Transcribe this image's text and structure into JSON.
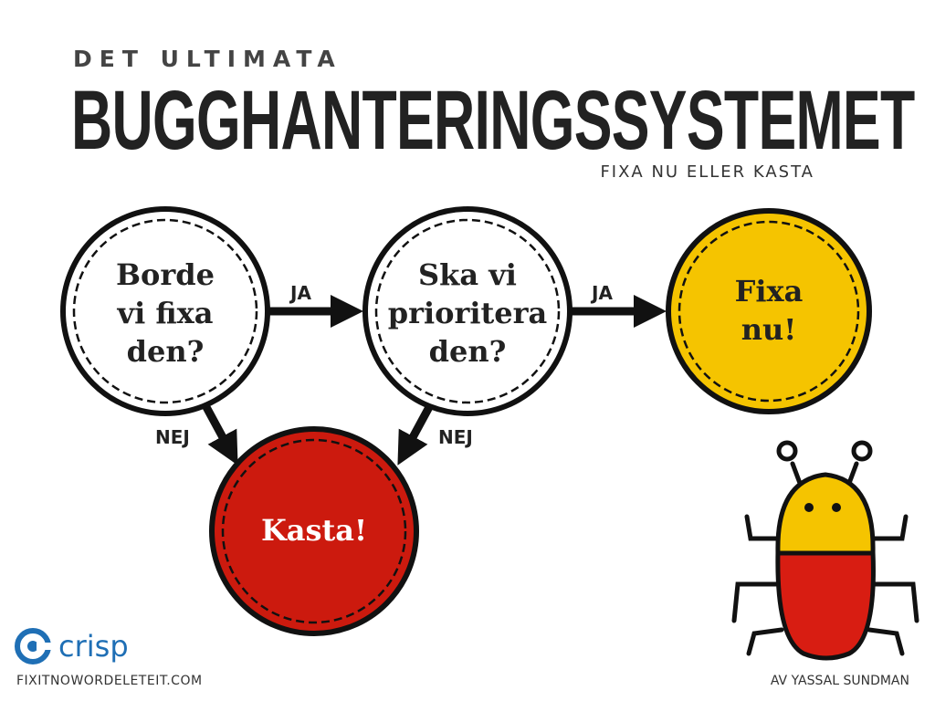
{
  "header": {
    "subtitle": "DET ULTIMATA",
    "title": "BUGGHANTERINGSSYSTEMET",
    "tagline": "FIXA NU ELLER KASTA"
  },
  "nodes": {
    "fix_question": [
      "Borde",
      "vi fixa",
      "den?"
    ],
    "prioritize_question": [
      "Ska vi",
      "prioritera",
      "den?"
    ],
    "fix_now": [
      "Fixa",
      "nu!"
    ],
    "discard": [
      "Kasta!"
    ]
  },
  "edges": {
    "yes_1": "JA",
    "yes_2": "JA",
    "no_1": "NEJ",
    "no_2": "NEJ"
  },
  "colors": {
    "yellow": "#f5c400",
    "red": "#cc1a0e",
    "outline": "#111111"
  },
  "footer": {
    "logo_text": "crisp",
    "website": "FIXITNOWORDELETEIT.COM",
    "credit": "AV YASSAL SUNDMAN"
  }
}
